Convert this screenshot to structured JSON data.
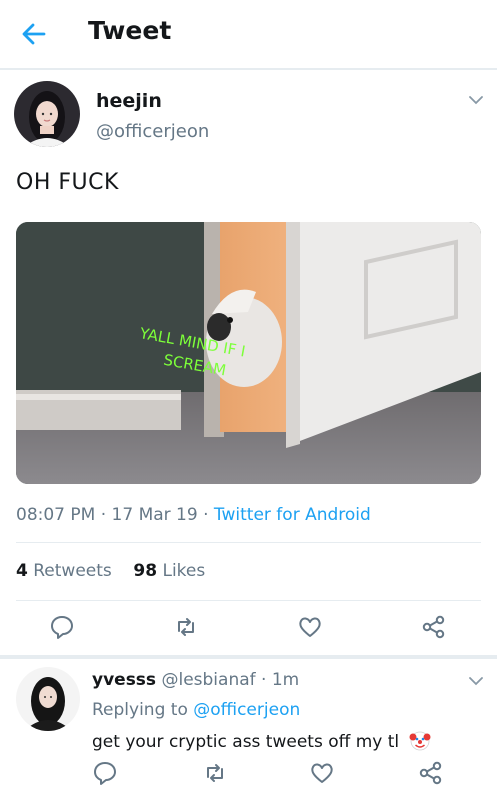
{
  "header": {
    "title": "Tweet"
  },
  "tweet": {
    "name": "heejin",
    "handle": "@officerjeon",
    "text": "OH FUCK",
    "image_caption_line1": "YALL MIND IF I",
    "image_caption_line2": "SCREAM",
    "time": "08:07 PM",
    "date": "17 Mar 19",
    "source": "Twitter for Android",
    "retweets_count": "4",
    "retweets_label": "Retweets",
    "likes_count": "98",
    "likes_label": "Likes"
  },
  "reply": {
    "name": "yvesss",
    "handle": "@lesbianaf",
    "time": "1m",
    "replying_prefix": "Replying to",
    "replying_to": "@officerjeon",
    "text": "get your cryptic ass tweets off my tl"
  },
  "icons": {
    "back": "arrow-left-icon",
    "caret": "chevron-down-icon",
    "reply": "reply-icon",
    "retweet": "retweet-icon",
    "like": "heart-icon",
    "share": "share-icon",
    "emoji": "clown-emoji"
  },
  "colors": {
    "accent": "#1da1f2",
    "secondary": "#657786",
    "divider": "#e6ecf0"
  }
}
